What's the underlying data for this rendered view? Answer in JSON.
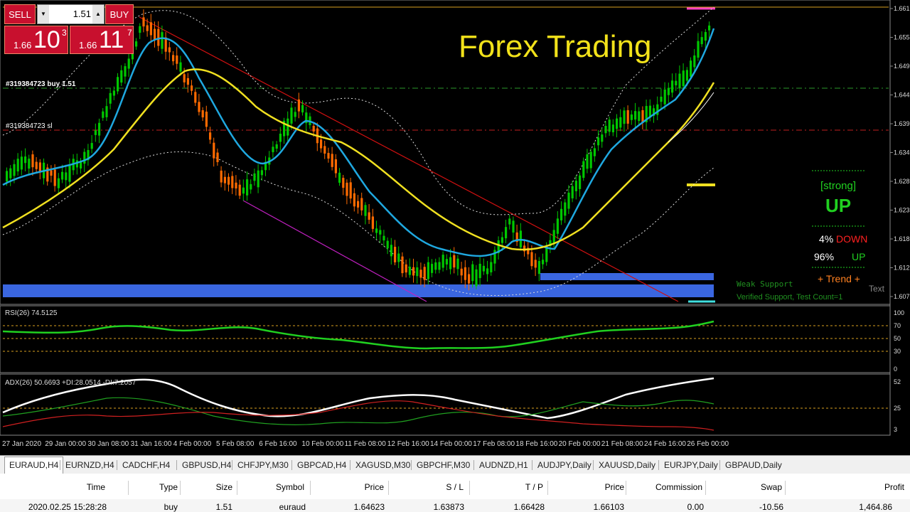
{
  "title_overlay": "Forex Trading",
  "trade_panel": {
    "sell_label": "SELL",
    "buy_label": "BUY",
    "lot": "1.51",
    "sell_price_prefix": "1.66",
    "sell_price_big": "10",
    "sell_price_sup": "3",
    "buy_price_prefix": "1.66",
    "buy_price_big": "11",
    "buy_price_sup": "7"
  },
  "order_lines": {
    "buy_label": "#319384723 buy 1.51",
    "sl_label": "#319384723 sl"
  },
  "price_scale": [
    "1.661",
    "1.655",
    "1.649",
    "1.644",
    "1.639",
    "1.634",
    "1.628",
    "1.623",
    "1.618",
    "1.612",
    "1.607"
  ],
  "indicator_panel": {
    "strong_label": "[strong]",
    "direction": "UP",
    "down_pct": "4%",
    "down_label": "DOWN",
    "up_pct": "96%",
    "up_label": "UP",
    "trend_label": "+  Trend  +",
    "weak_support": "Weak Support",
    "verified_support": "Verified Support, Test Count=1",
    "text_label": "Text"
  },
  "rsi": {
    "label": "RSI(26) 74.5125",
    "scale": [
      "100",
      "70",
      "50",
      "30",
      "0"
    ]
  },
  "adx": {
    "label": "ADX(26) 50.6693 +DI:28.0514 -DI:7.2057",
    "scale": [
      "52",
      "25",
      "3"
    ]
  },
  "time_axis": [
    "27 Jan 2020",
    "29 Jan 00:00",
    "30 Jan 08:00",
    "31 Jan 16:00",
    "4 Feb 00:00",
    "5 Feb 08:00",
    "6 Feb 16:00",
    "10 Feb 00:00",
    "11 Feb 08:00",
    "12 Feb 16:00",
    "14 Feb 00:00",
    "17 Feb 08:00",
    "18 Feb 16:00",
    "20 Feb 00:00",
    "21 Feb 08:00",
    "24 Feb 16:00",
    "26 Feb 00:00"
  ],
  "tabs": [
    "EURAUD,H4",
    "EURNZD,H4",
    "CADCHF,H4",
    "GBPUSD,H4",
    "CHFJPY,M30",
    "GBPCAD,H4",
    "XAGUSD,M30",
    "GBPCHF,M30",
    "AUDNZD,H1",
    "AUDJPY,Daily",
    "XAUUSD,Daily",
    "EURJPY,Daily",
    "GBPAUD,Daily"
  ],
  "trade_table": {
    "headers": [
      "Time",
      "Type",
      "Size",
      "Symbol",
      "Price",
      "S / L",
      "T / P",
      "Price",
      "Commission",
      "Swap",
      "Profit"
    ],
    "row": [
      "2020.02.25 15:28:28",
      "buy",
      "1.51",
      "euraud",
      "1.64623",
      "1.63873",
      "1.66428",
      "1.66103",
      "0.00",
      "-10.56",
      "1,464.86"
    ]
  },
  "colors": {
    "bull_candle": "#00c800",
    "bear_candle": "#ff6a00",
    "ma_fast": "#1fa8e0",
    "ma_slow": "#f0e020",
    "support_zone": "#3a66e0",
    "buy_line": "#2a9a2a",
    "sl_line": "#c02020",
    "title": "#f2e21a",
    "trade_button": "#c8102e"
  }
}
